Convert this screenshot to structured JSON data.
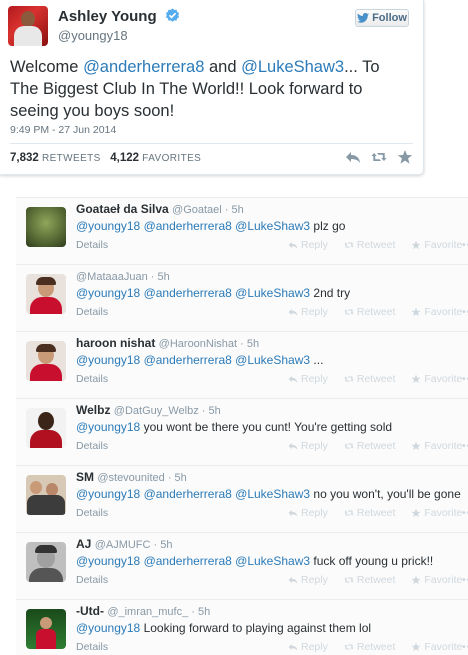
{
  "tweet": {
    "name": "Ashley Young",
    "handle": "@youngy18",
    "follow_label": "Follow",
    "text_parts": [
      {
        "t": "Welcome ",
        "m": false
      },
      {
        "t": "@anderherrera8",
        "m": true
      },
      {
        "t": " and ",
        "m": false
      },
      {
        "t": "@LukeShaw3",
        "m": true
      },
      {
        "t": "... To The Biggest Club In The World!! Look forward to seeing you boys soon!",
        "m": false
      }
    ],
    "timestamp": "9:49 PM - 27 Jun 2014",
    "retweets_count": "7,832",
    "retweets_label": "RETWEETS",
    "favorites_count": "4,122",
    "favorites_label": "FAVORITES",
    "icons": [
      "reply-icon",
      "retweet-icon",
      "favorite-icon"
    ],
    "accent": "#2b7bb9"
  },
  "reply_actions": {
    "details": "Details",
    "reply": "Reply",
    "retweet": "Retweet",
    "favorite": "Favorite",
    "more": "•••"
  },
  "replies": [
    {
      "name": "Goataeł da Silva",
      "handle": "@Goatael",
      "time": "· 5h",
      "avatar": "green",
      "text_parts": [
        {
          "t": "@youngy18",
          "m": true
        },
        {
          "t": " ",
          "m": false
        },
        {
          "t": "@anderherrera8",
          "m": true
        },
        {
          "t": " ",
          "m": false
        },
        {
          "t": "@LukeShaw3",
          "m": true
        },
        {
          "t": " plz go",
          "m": false
        }
      ]
    },
    {
      "name": "",
      "handle": "@MataaaJuan",
      "time": "· 5h",
      "avatar": "red-face",
      "text_parts": [
        {
          "t": "@youngy18",
          "m": true
        },
        {
          "t": " ",
          "m": false
        },
        {
          "t": "@anderherrera8",
          "m": true
        },
        {
          "t": " ",
          "m": false
        },
        {
          "t": "@LukeShaw3",
          "m": true
        },
        {
          "t": " 2nd try",
          "m": false
        }
      ]
    },
    {
      "name": "haroon nishat",
      "handle": "@HaroonNishat",
      "time": "· 5h",
      "avatar": "red-face",
      "text_parts": [
        {
          "t": "@youngy18",
          "m": true
        },
        {
          "t": " ",
          "m": false
        },
        {
          "t": "@anderherrera8",
          "m": true
        },
        {
          "t": " ",
          "m": false
        },
        {
          "t": "@LukeShaw3",
          "m": true
        },
        {
          "t": " ...",
          "m": false
        }
      ]
    },
    {
      "name": "Welbz",
      "handle": "@DatGuy_Welbz",
      "time": "· 5h",
      "avatar": "dark-red",
      "text_parts": [
        {
          "t": "@youngy18",
          "m": true
        },
        {
          "t": " you wont be there you cunt! You're getting sold",
          "m": false
        }
      ]
    },
    {
      "name": "SM",
      "handle": "@stevounited",
      "time": "· 5h",
      "avatar": "group",
      "text_parts": [
        {
          "t": "@youngy18",
          "m": true
        },
        {
          "t": " ",
          "m": false
        },
        {
          "t": "@anderherrera8",
          "m": true
        },
        {
          "t": " ",
          "m": false
        },
        {
          "t": "@LukeShaw3",
          "m": true
        },
        {
          "t": " no you won't, you'll be gone",
          "m": false
        }
      ]
    },
    {
      "name": "AJ",
      "handle": "@AJMUFC",
      "time": "· 5h",
      "avatar": "grey-face",
      "text_parts": [
        {
          "t": "@youngy18",
          "m": true
        },
        {
          "t": " ",
          "m": false
        },
        {
          "t": "@anderherrera8",
          "m": true
        },
        {
          "t": " ",
          "m": false
        },
        {
          "t": "@LukeShaw3",
          "m": true
        },
        {
          "t": " fuck off young u prick!!",
          "m": false
        }
      ]
    },
    {
      "name": "-Utd-",
      "handle": "@_imran_mufc_",
      "time": "· 5h",
      "avatar": "pitch",
      "text_parts": [
        {
          "t": "@youngy18",
          "m": true
        },
        {
          "t": " Looking forward to playing against them lol",
          "m": false
        }
      ]
    }
  ]
}
